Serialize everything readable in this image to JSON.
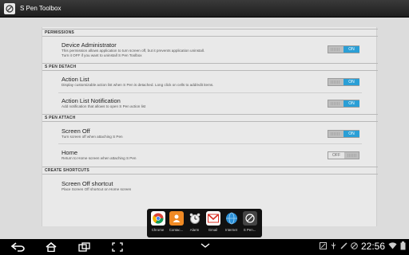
{
  "window": {
    "title": "S Pen Toolbox"
  },
  "sections": [
    {
      "label": "PERMISSIONS"
    },
    {
      "label": "S PEN DETACH"
    },
    {
      "label": "S PEN ATTACH"
    },
    {
      "label": "CREATE SHORTCUTS"
    }
  ],
  "items": [
    {
      "title": "Device Administrator",
      "desc1": "This permission allows application to turn screen off, but it prevents application uninstall.",
      "desc2": "Turn it OFF if you want to uninstall S Pen Toolbox",
      "toggle": "ON"
    },
    {
      "title": "Action List",
      "desc1": "Display customizable action list when S Pen is detached. Long click on cells to add/edit items.",
      "toggle": "ON"
    },
    {
      "title": "Action List Notification",
      "desc1": "Add notification that allows to open S Pen action list",
      "toggle": "ON"
    },
    {
      "title": "Screen Off",
      "desc1": "Turn screen off when attaching S Pen",
      "toggle": "ON"
    },
    {
      "title": "Home",
      "desc1": "Return to Home screen when attaching S Pen",
      "toggle": "OFF"
    },
    {
      "title": "Screen Off shortcut",
      "desc1": "Place Screen Off shortcut on Home screen"
    }
  ],
  "recents": [
    {
      "label": "Chrome",
      "icon": "chrome-icon",
      "color": "#4285f4"
    },
    {
      "label": "Contac...",
      "icon": "contacts-icon",
      "color": "#f08a24"
    },
    {
      "label": "Alarm",
      "icon": "alarm-icon",
      "color": "#ececec"
    },
    {
      "label": "Gmail",
      "icon": "gmail-icon",
      "color": "#d93025"
    },
    {
      "label": "Internet",
      "icon": "internet-icon",
      "color": "#2b8fd6"
    },
    {
      "label": "S Pen...",
      "icon": "spen-icon",
      "color": "#444444"
    }
  ],
  "statusbar": {
    "clock": "22:56"
  }
}
